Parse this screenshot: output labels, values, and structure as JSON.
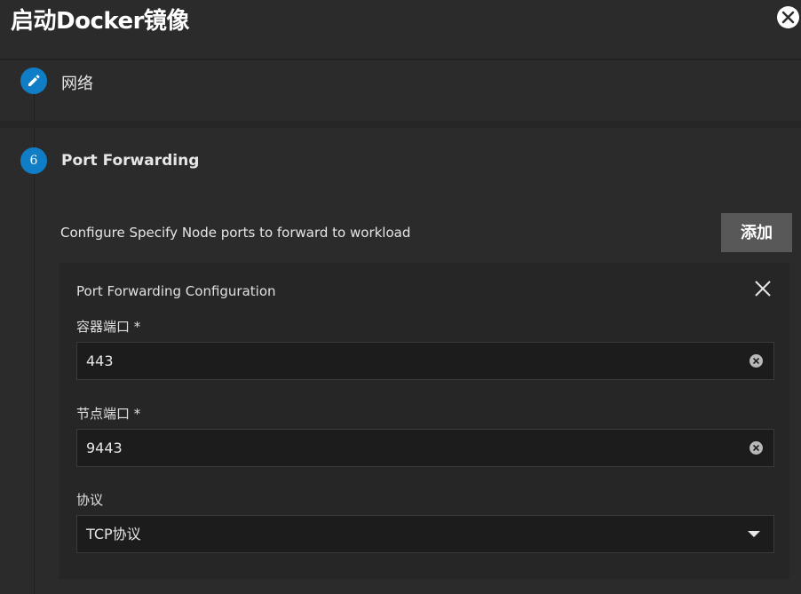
{
  "dialog": {
    "title": "启动Docker镜像"
  },
  "steps": [
    {
      "label": "网络",
      "icon": "pencil-icon"
    },
    {
      "number": "6",
      "label": "Port Forwarding"
    }
  ],
  "port_forwarding": {
    "description": "Configure Specify Node ports to forward to workload",
    "add_button_label": "添加",
    "card": {
      "title": "Port Forwarding Configuration",
      "fields": {
        "container_port": {
          "label": "容器端口 *",
          "value": "443"
        },
        "node_port": {
          "label": "节点端口 *",
          "value": "9443"
        },
        "protocol": {
          "label": "协议",
          "value": "TCP协议"
        }
      }
    }
  },
  "colors": {
    "background": "#2b2b2b",
    "accent": "#0f7ec6",
    "button": "#585858",
    "card": "#262626",
    "field": "#1c1c1c"
  }
}
